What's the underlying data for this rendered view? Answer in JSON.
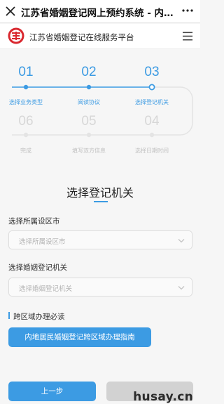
{
  "browser": {
    "title": "江苏省婚姻登记网上预约系统 - 内地居…",
    "close_icon": "close-icon",
    "more_icon": "more-dots-icon"
  },
  "app": {
    "title": "江苏省婚姻登记在线服务平台",
    "logo_icon": "double-happiness-logo",
    "menu_icon": "hamburger-menu-icon",
    "accent_color": "#3c9be3"
  },
  "steps": [
    {
      "num": "01",
      "label": "选择业务类型",
      "state": "done"
    },
    {
      "num": "02",
      "label": "阅读协议",
      "state": "done"
    },
    {
      "num": "03",
      "label": "选择登记机关",
      "state": "current"
    },
    {
      "num": "04",
      "label": "选择日期时间",
      "state": "todo"
    },
    {
      "num": "05",
      "label": "填写双方信息",
      "state": "todo"
    },
    {
      "num": "06",
      "label": "完成",
      "state": "todo"
    }
  ],
  "section": {
    "title": "选择登记机关"
  },
  "form": {
    "city_label": "选择所属设区市",
    "city_placeholder": "选择所属设区市",
    "office_label": "选择婚姻登记机关",
    "office_placeholder": "选择婚姻登记机关"
  },
  "notice": {
    "title": "跨区域办理必读",
    "guide_button": "内地居民婚姻登记跨区域办理指南"
  },
  "footer": {
    "prev_label": "上一步",
    "next_label": ""
  },
  "watermark": "husay.cn"
}
